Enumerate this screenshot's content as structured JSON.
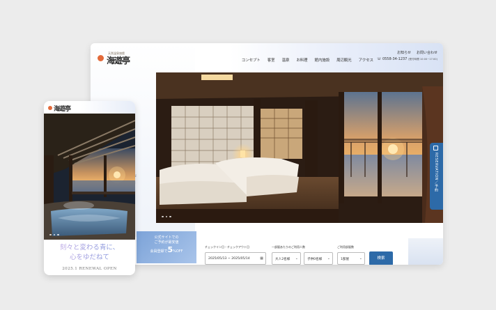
{
  "desktop": {
    "logo_tagline": "天然温泉旅館",
    "logo_name": "海遊亭",
    "nav": [
      "コンセプト",
      "客室",
      "温泉",
      "お料理",
      "館内施設",
      "周辺観光",
      "アクセス"
    ],
    "util_links": [
      "お知らせ",
      "お問い合わせ"
    ],
    "tel": "0558-34-1237",
    "tel_hours": "(受付時間 10:00~17:00)",
    "side_text": "N",
    "side_text2": "開",
    "reservation_label": "RESERVATION／予約",
    "booking": {
      "promo_line1": "公式サイトでの",
      "promo_line2": "ご予約が最安値",
      "promo_line3_prefix": "会員登録で",
      "promo_line3_big": "5",
      "promo_line3_suffix": "%OFF",
      "checkin_label": "チェックイン日・チェックアウト日",
      "date_value": "2025/05/13 ~ 2025/05/14",
      "guests_label": "一部屋あたりのご利用人数",
      "adults_value": "大人2名様",
      "children_value": "子供0名様",
      "rooms_label": "ご利用部屋数",
      "rooms_value": "1部屋",
      "search_label": "検索"
    },
    "accent_color": "#2d6aa8"
  },
  "mobile": {
    "logo_name": "海遊亭",
    "catch_line1": "刻々と変わる青に、",
    "catch_line2": "心をゆだねて",
    "renewal": "2025.1 RENEWAL OPEN"
  }
}
